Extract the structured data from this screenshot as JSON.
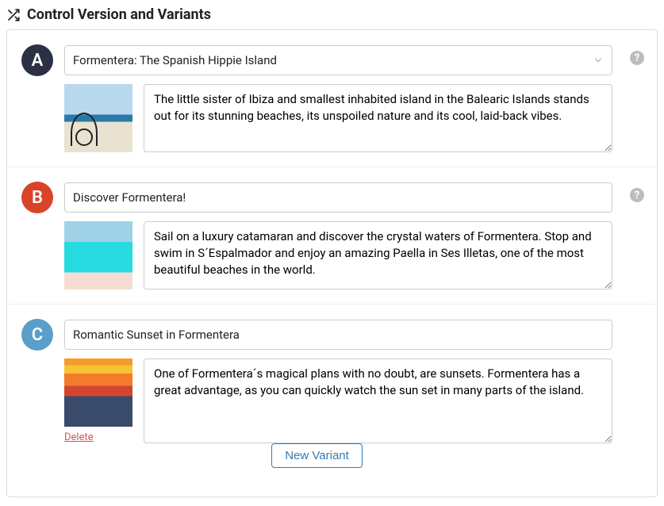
{
  "header": {
    "title": "Control Version and Variants"
  },
  "variants": [
    {
      "letter": "A",
      "badge_color": "#2c3044",
      "title": "Formentera: The Spanish Hippie Island",
      "description": "The little sister of Ibiza and smallest inhabited island in the Balearic Islands stands out for its stunning beaches, its unspoiled nature and its cool, laid-back vibes.",
      "is_dropdown": true,
      "show_help": true,
      "show_delete": false,
      "thumb_icon": "beach-bicycle-thumb"
    },
    {
      "letter": "B",
      "badge_color": "#d9432a",
      "title": "Discover Formentera!",
      "description": "Sail on a luxury catamaran and discover the crystal waters of Formentera. Stop and swim in S´Espalmador and enjoy an amazing Paella in Ses Illetas, one of the most beautiful beaches in the world.",
      "is_dropdown": false,
      "show_help": true,
      "show_delete": false,
      "thumb_icon": "turquoise-water-thumb"
    },
    {
      "letter": "C",
      "badge_color": "#5a9ec9",
      "title": "Romantic Sunset in Formentera",
      "description": "One of Formentera´s magical plans with no doubt, are sunsets. Formentera has a great advantage, as you can quickly watch the sun set in many parts of the island.",
      "is_dropdown": false,
      "show_help": false,
      "show_delete": true,
      "thumb_icon": "sunset-thumb"
    }
  ],
  "labels": {
    "delete": "Delete",
    "new_variant": "New Variant",
    "help_glyph": "?"
  }
}
